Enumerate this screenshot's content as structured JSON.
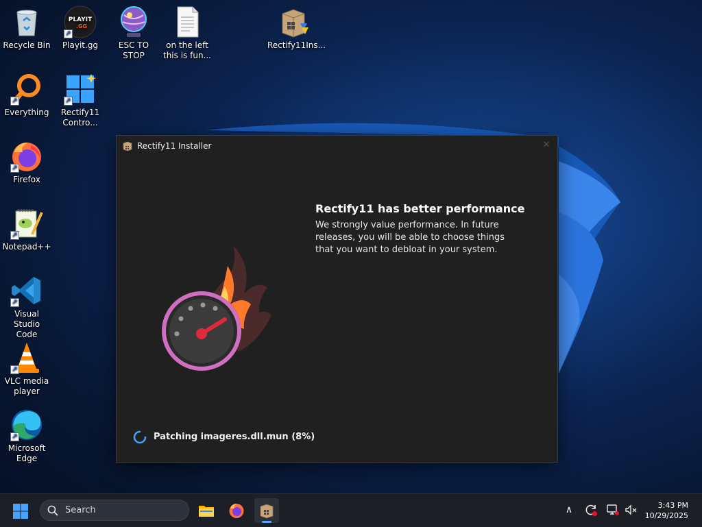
{
  "desktop": {
    "icons": [
      {
        "id": "recycle-bin",
        "label": "Recycle Bin",
        "icon": "recycle-bin-icon",
        "shortcut": false
      },
      {
        "id": "playit",
        "label": "Playit.gg",
        "icon": "playit-icon",
        "badge_top": "PLAYIT",
        "badge_bottom": ".GG",
        "shortcut": true
      },
      {
        "id": "esc-to-stop",
        "label": "ESC TO STOP",
        "icon": "globe-icon",
        "shortcut": false
      },
      {
        "id": "text-file",
        "label_line1": "on the left",
        "label_line2": "this is fun...",
        "icon": "text-file-icon",
        "shortcut": false
      },
      {
        "id": "rectify-installer",
        "label": "Rectify11Ins...",
        "icon": "installer-box-icon",
        "shortcut": false
      },
      {
        "id": "everything",
        "label": "Everything",
        "icon": "magnifier-icon",
        "shortcut": true
      },
      {
        "id": "rectify-control",
        "label_line1": "Rectify11",
        "label_line2": "Contro...",
        "icon": "windows-tiles-icon",
        "shortcut": true
      },
      {
        "id": "firefox",
        "label": "Firefox",
        "icon": "firefox-icon",
        "shortcut": true
      },
      {
        "id": "notepadpp",
        "label": "Notepad++",
        "icon": "notepadpp-icon",
        "shortcut": true
      },
      {
        "id": "vscode",
        "label_line1": "Visual Studio",
        "label_line2": "Code",
        "icon": "vscode-icon",
        "shortcut": true
      },
      {
        "id": "vlc",
        "label_line1": "VLC media",
        "label_line2": "player",
        "icon": "vlc-cone-icon",
        "shortcut": true
      },
      {
        "id": "edge",
        "label_line1": "Microsoft",
        "label_line2": "Edge",
        "icon": "edge-icon",
        "shortcut": true
      }
    ]
  },
  "installer": {
    "title": "Rectify11 Installer",
    "close_glyph": "✕",
    "heading": "Rectify11 has better performance",
    "description": "We strongly value performance. In future releases, you will be able to choose things that you want to debloat in your system.",
    "progress_text": "Patching imageres.dll.mun (8%)",
    "progress_percent": 8
  },
  "taskbar": {
    "search_label": "Search",
    "pinned": [
      {
        "id": "file-explorer",
        "icon": "folder-icon",
        "active": false
      },
      {
        "id": "firefox",
        "icon": "firefox-icon",
        "active": false
      },
      {
        "id": "rectify-installer",
        "icon": "installer-box-icon",
        "active": true
      }
    ],
    "tray": {
      "overflow_glyph": "∧",
      "icons": [
        "sync-alert-icon",
        "network-icon",
        "volume-muted-icon"
      ]
    },
    "clock": {
      "time": "3:43 PM",
      "date": "10/29/2025"
    }
  },
  "colors": {
    "accent": "#0078d4",
    "dialog_bg": "#202020",
    "taskbar_bg": "#1c1f26",
    "flame_orange": "#ff7a2a",
    "gauge_pink": "#d06ec0",
    "needle_red": "#e02a3a"
  }
}
